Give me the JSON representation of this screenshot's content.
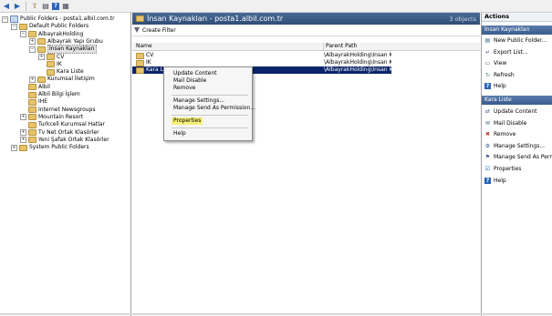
{
  "tree": {
    "items": [
      {
        "label": "Public Folders - posta1.albil.com.tr",
        "indent": 0,
        "exp": "−",
        "kind": "root"
      },
      {
        "label": "Default Public Folders",
        "indent": 1,
        "exp": "−",
        "kind": "folder"
      },
      {
        "label": "AlbayrakHolding",
        "indent": 2,
        "exp": "−",
        "kind": "folder"
      },
      {
        "label": "Albayrak Yapı Grubu",
        "indent": 3,
        "exp": "+",
        "kind": "folder"
      },
      {
        "label": "İnsan Kaynakları",
        "indent": 3,
        "exp": "−",
        "kind": "folder",
        "selected": true
      },
      {
        "label": "CV",
        "indent": 4,
        "exp": "+",
        "kind": "folder"
      },
      {
        "label": "IK",
        "indent": 4,
        "exp": "",
        "kind": "folder"
      },
      {
        "label": "Kara Liste",
        "indent": 4,
        "exp": "",
        "kind": "folder"
      },
      {
        "label": "Kurumsal İletişim",
        "indent": 3,
        "exp": "+",
        "kind": "folder"
      },
      {
        "label": "Albil",
        "indent": 2,
        "exp": "",
        "kind": "folder"
      },
      {
        "label": "Albil Bilgi İşlem",
        "indent": 2,
        "exp": "",
        "kind": "folder"
      },
      {
        "label": "IHE",
        "indent": 2,
        "exp": "",
        "kind": "folder"
      },
      {
        "label": "Internet Newsgroups",
        "indent": 2,
        "exp": "",
        "kind": "folder"
      },
      {
        "label": "Mountain Resort",
        "indent": 2,
        "exp": "+",
        "kind": "folder"
      },
      {
        "label": "Turkcell Kurumsal Hatlar",
        "indent": 2,
        "exp": "",
        "kind": "folder"
      },
      {
        "label": "Tv Net Ortak Klasörler",
        "indent": 2,
        "exp": "+",
        "kind": "folder"
      },
      {
        "label": "Yeni Şafak Ortak Klasörler",
        "indent": 2,
        "exp": "+",
        "kind": "folder"
      },
      {
        "label": "System Public Folders",
        "indent": 1,
        "exp": "+",
        "kind": "folder"
      }
    ]
  },
  "center": {
    "title": "İnsan Kaynakları - posta1.albil.com.tr",
    "count": "3 objects",
    "create_filter": "Create Filter",
    "col_name": "Name",
    "col_parent": "Parent Path",
    "rows": [
      {
        "name": "CV",
        "parent": "\\AlbayrakHolding\\İnsan K..."
      },
      {
        "name": "IK",
        "parent": "\\AlbayrakHolding\\İnsan K..."
      },
      {
        "name": "Kara Liste",
        "parent": "\\AlbayrakHolding\\İnsan K...",
        "selected": true
      }
    ]
  },
  "context_menu": {
    "update_content": "Update Content",
    "mail_disable": "Mail Disable",
    "remove": "Remove",
    "manage_settings": "Manage Settings...",
    "manage_send_as": "Manage Send As Permission...",
    "properties": "Properties",
    "help": "Help"
  },
  "actions": {
    "title": "Actions",
    "section1": "İnsan Kaynakları",
    "items1": [
      {
        "label": "New Public Folder...",
        "icon": "new-folder-icon"
      },
      {
        "label": "Export List...",
        "icon": "export-icon"
      },
      {
        "label": "View",
        "icon": "view-icon"
      },
      {
        "label": "Refresh",
        "icon": "refresh-icon"
      },
      {
        "label": "Help",
        "icon": "help-icon"
      }
    ],
    "section2": "Kara Liste",
    "items2": [
      {
        "label": "Update Content",
        "icon": "update-icon"
      },
      {
        "label": "Mail Disable",
        "icon": "mail-disable-icon"
      },
      {
        "label": "Remove",
        "icon": "remove-icon"
      },
      {
        "label": "Manage Settings...",
        "icon": "settings-icon"
      },
      {
        "label": "Manage Send As Permission...",
        "icon": "permission-icon"
      },
      {
        "label": "Properties",
        "icon": "properties-icon"
      },
      {
        "label": "Help",
        "icon": "help-icon"
      }
    ]
  },
  "colors": {
    "header": "#2f4d76",
    "selection": "#0a246a",
    "highlight": "#f7f078"
  }
}
